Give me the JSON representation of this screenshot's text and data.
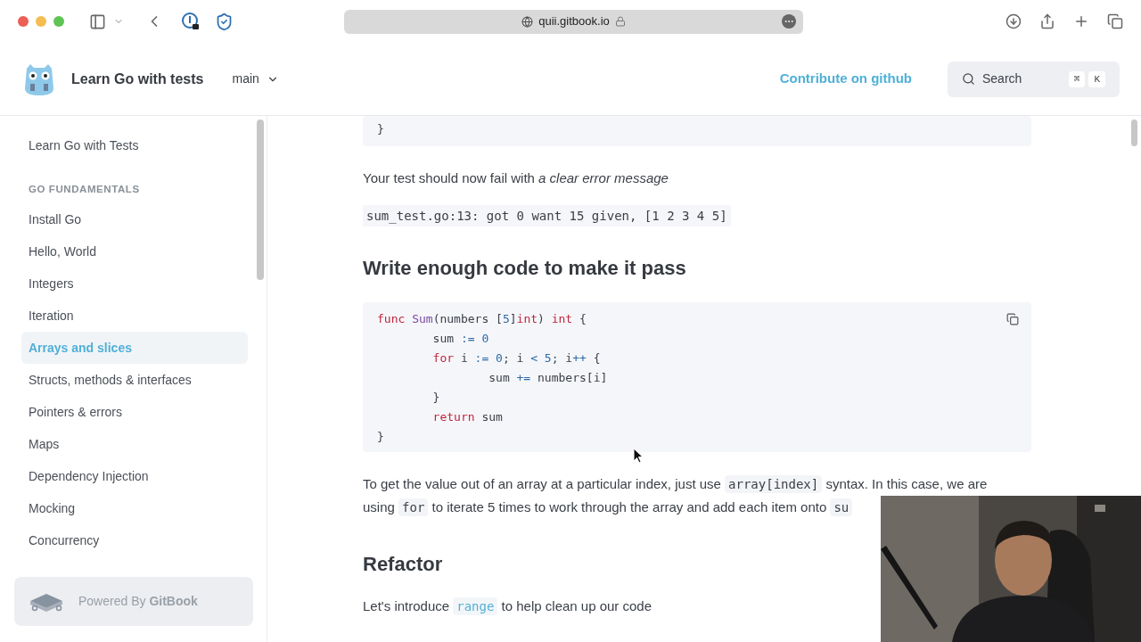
{
  "browser": {
    "url": "quii.gitbook.io"
  },
  "header": {
    "title": "Learn Go with tests",
    "branch": "main",
    "contribute_link": "Contribute on github",
    "search": {
      "placeholder": "Search",
      "keys": [
        "⌘",
        "K"
      ]
    }
  },
  "sidebar": {
    "items": [
      {
        "label": "Learn Go with Tests",
        "selected": false
      }
    ],
    "groups": [
      {
        "title": "GO FUNDAMENTALS",
        "items": [
          {
            "label": "Install Go",
            "selected": false
          },
          {
            "label": "Hello, World",
            "selected": false
          },
          {
            "label": "Integers",
            "selected": false
          },
          {
            "label": "Iteration",
            "selected": false
          },
          {
            "label": "Arrays and slices",
            "selected": true
          },
          {
            "label": "Structs, methods & interfaces",
            "selected": false
          },
          {
            "label": "Pointers & errors",
            "selected": false
          },
          {
            "label": "Maps",
            "selected": false
          },
          {
            "label": "Dependency Injection",
            "selected": false
          },
          {
            "label": "Mocking",
            "selected": false
          },
          {
            "label": "Concurrency",
            "selected": false
          }
        ]
      }
    ],
    "footer": "Powered By **GitBook**"
  },
  "content": [
    {
      "kind": "code",
      "copy": false,
      "lines": [
        [
          {
            "text": "}",
            "kind": "plain"
          }
        ]
      ]
    },
    {
      "kind": "paragraph",
      "segments": [
        {
          "text": "Your test should now fail with ",
          "kind": "text"
        },
        {
          "text": "a clear error message",
          "kind": "em"
        }
      ]
    },
    {
      "kind": "output",
      "text": "sum_test.go:13: got 0 want 15 given, [1 2 3 4 5]"
    },
    {
      "kind": "heading",
      "text": "Write enough code to make it pass"
    },
    {
      "kind": "code",
      "copy": true,
      "lines": [
        [
          {
            "text": "func",
            "kind": "keyword"
          },
          {
            "text": " Sum",
            "kind": "function"
          },
          {
            "text": "(numbers [",
            "kind": "plain"
          },
          {
            "text": "5",
            "kind": "number"
          },
          {
            "text": "]",
            "kind": "plain"
          },
          {
            "text": "int",
            "kind": "keyword"
          },
          {
            "text": ") ",
            "kind": "plain"
          },
          {
            "text": "int",
            "kind": "keyword"
          },
          {
            "text": " {",
            "kind": "plain"
          }
        ],
        [
          {
            "text": "        sum ",
            "kind": "plain"
          },
          {
            "text": ":=",
            "kind": "operator"
          },
          {
            "text": " 0",
            "kind": "number"
          }
        ],
        [
          {
            "text": "        for",
            "kind": "keyword"
          },
          {
            "text": " i ",
            "kind": "plain"
          },
          {
            "text": ":=",
            "kind": "operator"
          },
          {
            "text": " 0",
            "kind": "number"
          },
          {
            "text": "; i ",
            "kind": "plain"
          },
          {
            "text": "<",
            "kind": "operator"
          },
          {
            "text": " 5",
            "kind": "number"
          },
          {
            "text": "; i",
            "kind": "plain"
          },
          {
            "text": "++",
            "kind": "operator"
          },
          {
            "text": " {",
            "kind": "plain"
          }
        ],
        [
          {
            "text": "                sum ",
            "kind": "plain"
          },
          {
            "text": "+=",
            "kind": "operator"
          },
          {
            "text": " numbers[i]",
            "kind": "plain"
          }
        ],
        [
          {
            "text": "        }",
            "kind": "plain"
          }
        ],
        [
          {
            "text": "        return",
            "kind": "keyword"
          },
          {
            "text": " sum",
            "kind": "plain"
          }
        ],
        [
          {
            "text": "}",
            "kind": "plain"
          }
        ]
      ]
    },
    {
      "kind": "paragraph",
      "segments": [
        {
          "text": "To get the value out of an array at a particular index, just use ",
          "kind": "text"
        },
        {
          "text": "array[index]",
          "kind": "code"
        },
        {
          "text": " syntax. In this case, we are using ",
          "kind": "text"
        },
        {
          "text": "for",
          "kind": "code"
        },
        {
          "text": " to iterate 5 times to work through the array and add each item onto ",
          "kind": "text"
        },
        {
          "text": "su",
          "kind": "code"
        }
      ]
    },
    {
      "kind": "heading",
      "text": "Refactor"
    },
    {
      "kind": "paragraph",
      "segments": [
        {
          "text": "Let's introduce ",
          "kind": "text"
        },
        {
          "text": "range",
          "kind": "code_link"
        },
        {
          "text": " to help clean up our code",
          "kind": "text"
        }
      ]
    }
  ]
}
